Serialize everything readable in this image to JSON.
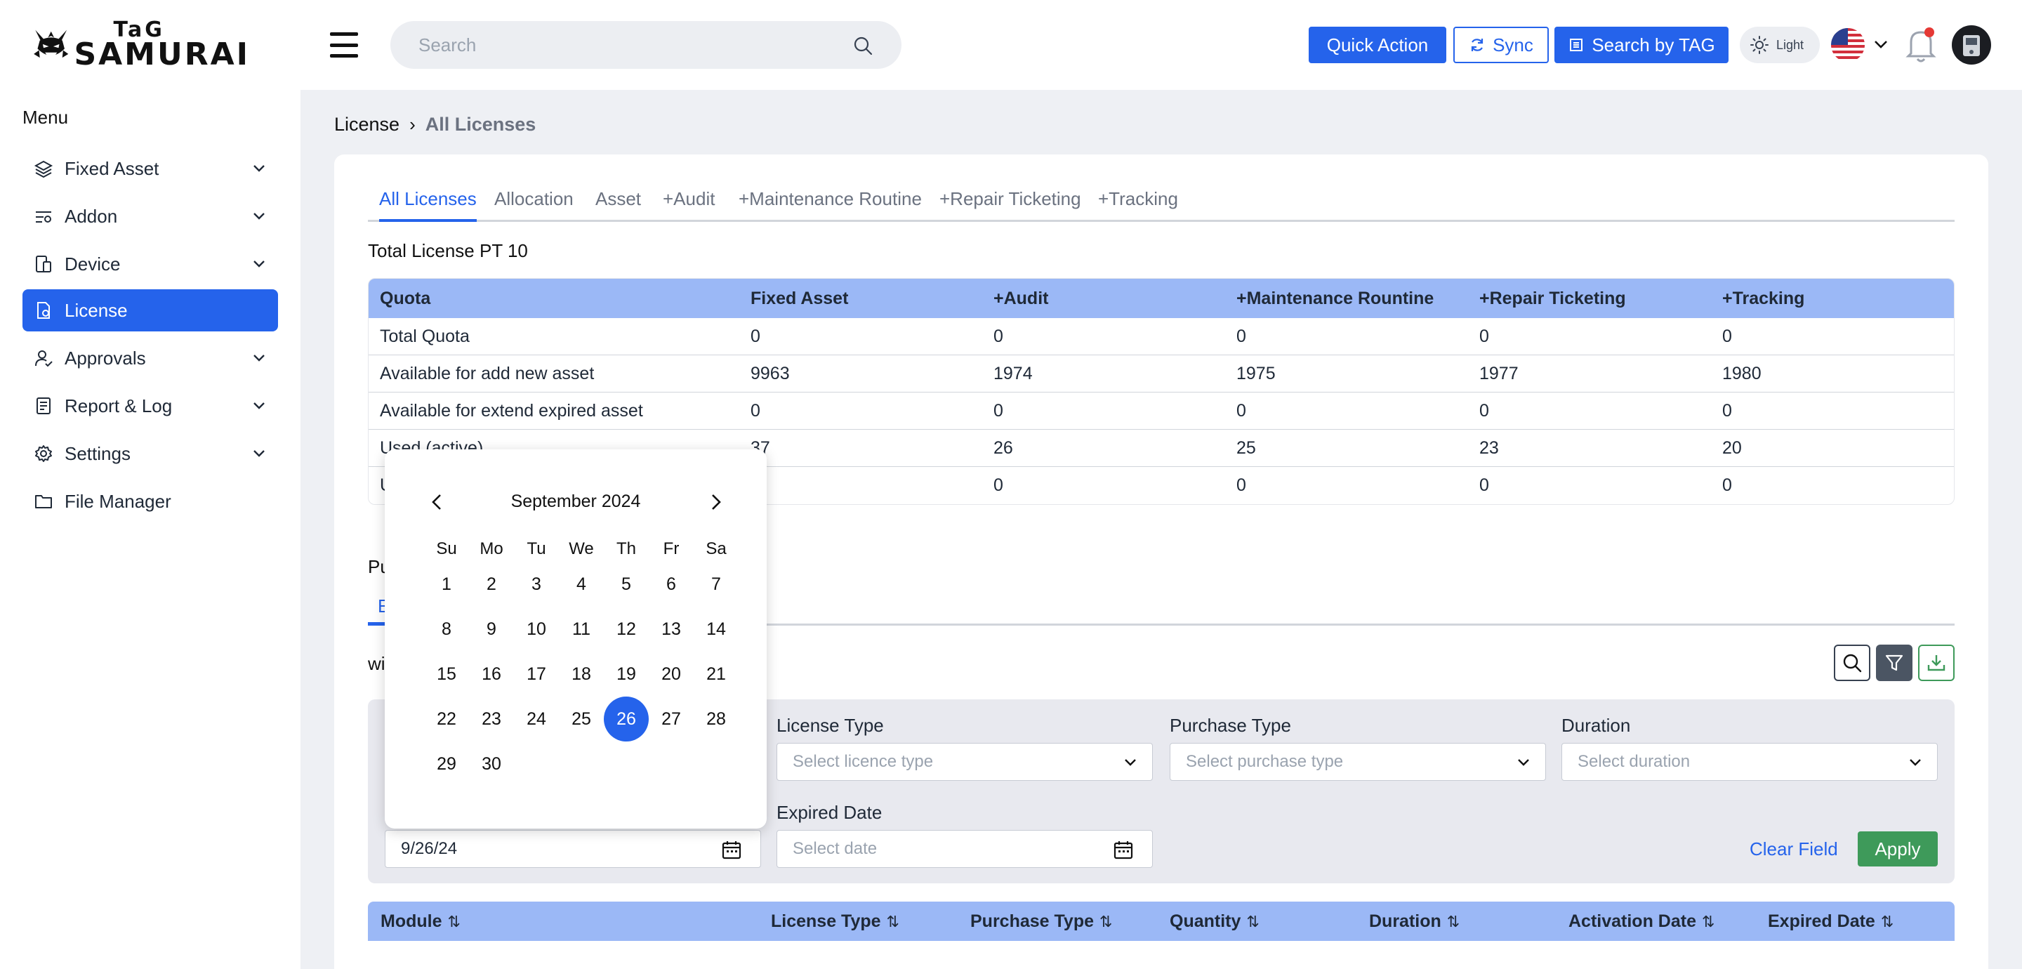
{
  "header": {
    "logo_text_top": "TaG",
    "logo_text_bottom": "SAMURAI",
    "search_placeholder": "Search",
    "quick_action_label": "Quick Action",
    "sync_label": "Sync",
    "search_by_tag_label": "Search by TAG",
    "theme_label": "Light"
  },
  "sidebar": {
    "menu_title": "Menu",
    "items": [
      {
        "label": "Fixed Asset",
        "icon": "layers-icon",
        "expandable": true
      },
      {
        "label": "Addon",
        "icon": "sliders-icon",
        "expandable": true
      },
      {
        "label": "Device",
        "icon": "device-icon",
        "expandable": true
      },
      {
        "label": "License",
        "icon": "license-icon",
        "expandable": false,
        "active": true
      },
      {
        "label": "Approvals",
        "icon": "user-check-icon",
        "expandable": true
      },
      {
        "label": "Report & Log",
        "icon": "report-icon",
        "expandable": true
      },
      {
        "label": "Settings",
        "icon": "gear-icon",
        "expandable": true
      },
      {
        "label": "File Manager",
        "icon": "folder-icon",
        "expandable": false
      }
    ]
  },
  "breadcrumb": {
    "parent": "License",
    "separator": "›",
    "current": "All Licenses"
  },
  "tabs": [
    "All Licenses",
    "Allocation",
    "Asset",
    "+Audit",
    "+Maintenance Routine",
    "+Repair Ticketing",
    "+Tracking"
  ],
  "total_license": "Total License PT 10",
  "quota_table": {
    "headers": [
      "Quota",
      "Fixed Asset",
      "+Audit",
      "+Maintenance Rountine",
      "+Repair Ticketing",
      "+Tracking"
    ],
    "rows": [
      [
        "Total Quota",
        "0",
        "0",
        "0",
        "0",
        "0"
      ],
      [
        "Available for add new asset",
        "9963",
        "1974",
        "1975",
        "1977",
        "1980"
      ],
      [
        "Available for extend expired asset",
        "0",
        "0",
        "0",
        "0",
        "0"
      ],
      [
        "Used (active)",
        "37",
        "26",
        "25",
        "23",
        "20"
      ],
      [
        "U",
        "",
        "0",
        "0",
        "0",
        "0"
      ]
    ]
  },
  "fragments": {
    "section_title": "Pu",
    "sub_tab": "E",
    "row_text": "wi"
  },
  "filters": {
    "license_type_label": "License Type",
    "license_type_placeholder": "Select licence type",
    "purchase_type_label": "Purchase Type",
    "purchase_type_placeholder": "Select purchase type",
    "duration_label": "Duration",
    "duration_placeholder": "Select duration",
    "expired_date_label": "Expired Date",
    "expired_date_placeholder": "Select date",
    "activation_date_value": "9/26/24",
    "clear_label": "Clear Field",
    "apply_label": "Apply"
  },
  "data_table": {
    "headers": [
      "Module",
      "License Type",
      "Purchase Type",
      "Quantity",
      "Duration",
      "Activation Date",
      "Expired Date"
    ],
    "sort_glyph": "⇅"
  },
  "calendar": {
    "month": "September",
    "year": "2024",
    "weekdays": [
      "Su",
      "Mo",
      "Tu",
      "We",
      "Th",
      "Fr",
      "Sa"
    ],
    "days": [
      "1",
      "2",
      "3",
      "4",
      "5",
      "6",
      "7",
      "8",
      "9",
      "10",
      "11",
      "12",
      "13",
      "14",
      "15",
      "16",
      "17",
      "18",
      "19",
      "20",
      "21",
      "22",
      "23",
      "24",
      "25",
      "26",
      "27",
      "28",
      "29",
      "30"
    ],
    "selected": "26"
  },
  "colors": {
    "accent": "#2563eb",
    "table_header": "#9bb8f6",
    "apply": "#3e9a5a"
  }
}
